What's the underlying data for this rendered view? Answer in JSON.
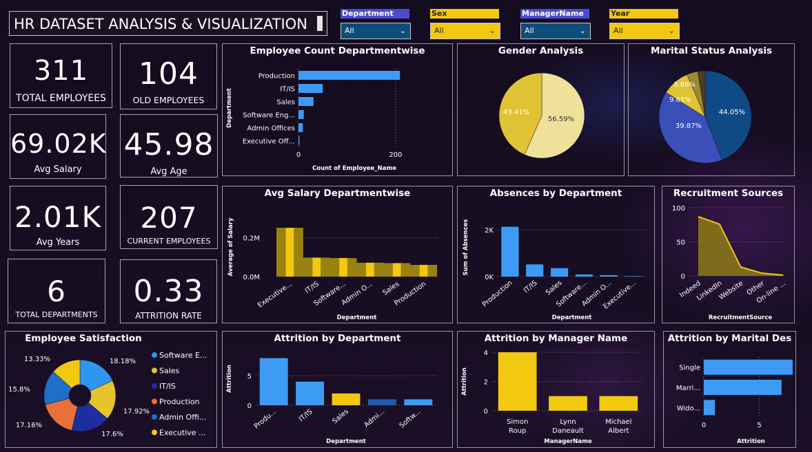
{
  "title": "HR DATASET ANALYSIS & VISUALIZATION",
  "slicers": [
    {
      "label": "Department",
      "value": "All",
      "color": "#4b4bd1"
    },
    {
      "label": "Sex",
      "value": "All",
      "color": "#f2c811"
    },
    {
      "label": "ManagerName",
      "value": "All",
      "color": "#4b4bd1"
    },
    {
      "label": "Year",
      "value": "All",
      "color": "#f2c811"
    }
  ],
  "kpis": {
    "total_employees": {
      "value": "311",
      "label": "TOTAL EMPLOYEES"
    },
    "old_employees": {
      "value": "104",
      "label": "OLD EMPLOYEES"
    },
    "avg_salary": {
      "value": "69.02K",
      "label": "Avg Salary"
    },
    "avg_age": {
      "value": "45.98",
      "label": "Avg Age"
    },
    "avg_years": {
      "value": "2.01K",
      "label": "Avg Years"
    },
    "current_employees": {
      "value": "207",
      "label": "CURRENT EMPLOYEES"
    },
    "total_departments": {
      "value": "6",
      "label": "TOTAL DEPARTMENTS"
    },
    "attrition_rate": {
      "value": "0.33",
      "label": "ATTRITION RATE"
    }
  },
  "colors": {
    "blue": "#3e9bf5",
    "yellow": "#f2c811",
    "navy": "#1c3fa8",
    "dark_blue": "#1f5cb0",
    "gold": "#e0c235",
    "pale": "#efe19a",
    "orange": "#e8703a"
  },
  "chart_data": [
    {
      "id": "employee-count",
      "type": "bar",
      "orientation": "horizontal",
      "title": "Employee Count Departmentwise",
      "categories": [
        "Production",
        "IT/IS",
        "Sales",
        "Software Eng...",
        "Admin Offices",
        "Executive Off..."
      ],
      "values": [
        209,
        50,
        31,
        11,
        9,
        1
      ],
      "xlabel": "Count of Employee_Name",
      "ylabel": "Department",
      "xticks": [
        "0",
        "200"
      ],
      "xlim": [
        0,
        230
      ]
    },
    {
      "id": "gender",
      "type": "pie",
      "title": "Gender Analysis",
      "labels": [
        "56.59%",
        "43.41%"
      ],
      "values": [
        56.59,
        43.41
      ]
    },
    {
      "id": "marital",
      "type": "pie",
      "title": "Marital Status Analysis",
      "labels": [
        "44.05%",
        "39.87%",
        "9.65%",
        "3.86%"
      ],
      "values": [
        44.05,
        39.87,
        9.65,
        3.86,
        2.57
      ]
    },
    {
      "id": "avg-salary",
      "type": "area",
      "title": "Avg Salary Departmentwise",
      "categories": [
        "Executive...",
        "IT/IS",
        "Software...",
        "Admin O...",
        "Sales",
        "Production"
      ],
      "values": [
        250000,
        97000,
        95000,
        71000,
        69000,
        60000
      ],
      "xlabel": "Department",
      "ylabel": "Average of Salary",
      "yticks": [
        "0.0M",
        "0.2M"
      ],
      "ylim": [
        0,
        300000
      ]
    },
    {
      "id": "absences",
      "type": "bar",
      "title": "Absences by Department",
      "categories": [
        "Production",
        "IT/IS",
        "Sales",
        "Software...",
        "Admin O...",
        "Executive..."
      ],
      "values": [
        2130,
        520,
        360,
        90,
        60,
        20
      ],
      "xlabel": "Department",
      "ylabel": "Sum of Absences",
      "yticks": [
        "0K",
        "2K"
      ],
      "ylim": [
        0,
        2500
      ]
    },
    {
      "id": "recruitment",
      "type": "area",
      "title": "Recruitment Sources",
      "categories": [
        "Indeed",
        "LinkedIn",
        "Website",
        "Other",
        "On-line ..."
      ],
      "values": [
        87,
        76,
        13,
        4,
        1
      ],
      "xlabel": "RecruitmentSource",
      "ylabel": "",
      "yticks": [
        "0",
        "50",
        "100"
      ],
      "ylim": [
        0,
        100
      ]
    },
    {
      "id": "satisfaction",
      "type": "pie",
      "title": "Employee Satisfaction",
      "labels": [
        "18.18%",
        "17.92%",
        "17.6%",
        "17.16%",
        "15.8%",
        "13.33%"
      ],
      "values": [
        18.18,
        17.92,
        17.6,
        17.16,
        15.8,
        13.33
      ],
      "legend": [
        "Software E...",
        "Sales",
        "IT/IS",
        "Production",
        "Admin Offi...",
        "Executive ..."
      ]
    },
    {
      "id": "attrition-dept",
      "type": "bar",
      "title": "Attrition by Department",
      "categories": [
        "Produ...",
        "IT/IS",
        "Sales",
        "Admi...",
        "Softw..."
      ],
      "values": [
        8,
        4,
        2,
        1,
        1
      ],
      "xlabel": "Department",
      "ylabel": "Attrition",
      "yticks": [
        "0",
        "5"
      ],
      "ylim": [
        0,
        9
      ]
    },
    {
      "id": "attrition-manager",
      "type": "bar",
      "title": "Attrition by Manager Name",
      "categories": [
        "Simon Roup",
        "Lynn Daneault",
        "Michael Albert"
      ],
      "values": [
        4,
        1,
        1
      ],
      "xlabel": "ManagerName",
      "ylabel": "Attrition",
      "yticks": [
        "0",
        "2",
        "4"
      ],
      "ylim": [
        0,
        4
      ]
    },
    {
      "id": "attrition-marital",
      "type": "bar",
      "orientation": "horizontal",
      "title": "Attrition by Marital Des",
      "categories": [
        "Single",
        "Marri...",
        "Wido..."
      ],
      "values": [
        8,
        7,
        1
      ],
      "xlabel": "Attrition",
      "ylabel": "",
      "xticks": [
        "0",
        "5"
      ],
      "xlim": [
        0,
        8.5
      ]
    }
  ]
}
